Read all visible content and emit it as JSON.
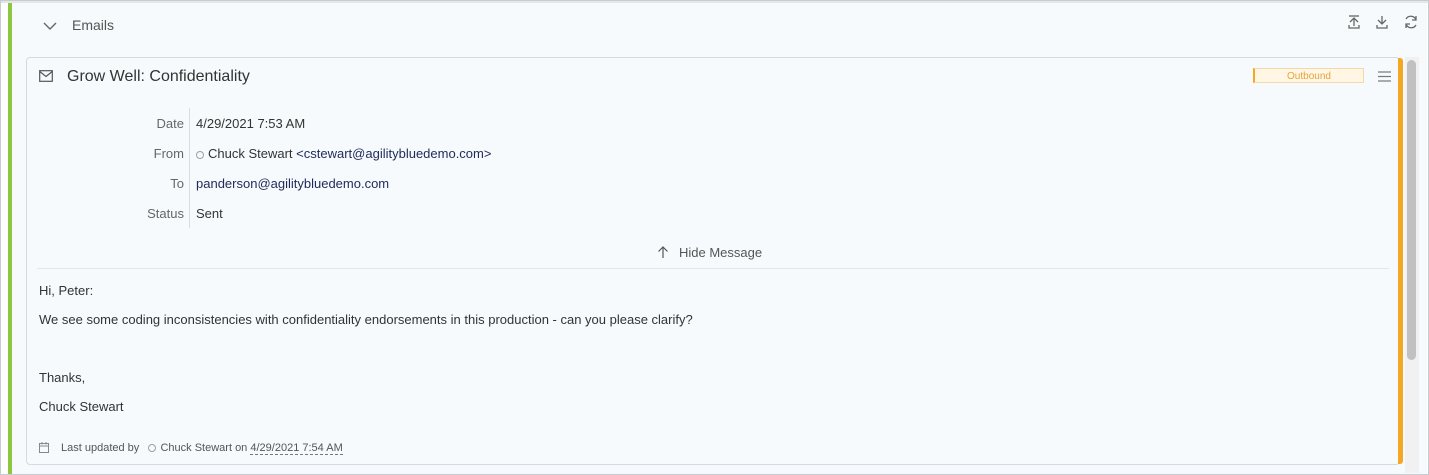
{
  "section": {
    "title": "Emails"
  },
  "email": {
    "subject": "Grow Well: Confidentiality",
    "badge": "Outbound",
    "fields": {
      "date_label": "Date",
      "date_value": "4/29/2021 7:53 AM",
      "from_label": "From",
      "from_name": "Chuck Stewart",
      "from_email": "<cstewart@agilitybluedemo.com>",
      "to_label": "To",
      "to_value": "panderson@agilitybluedemo.com",
      "status_label": "Status",
      "status_value": "Sent"
    },
    "hide_message_label": "Hide Message",
    "body": {
      "greeting": "Hi, Peter:",
      "line1": "We see some coding inconsistencies with confidentiality endorsements in this production - can you please clarify?",
      "closing": "Thanks,",
      "signature": "Chuck Stewart"
    },
    "footer": {
      "prefix": "Last updated by",
      "user": "Chuck Stewart",
      "on": "on",
      "date": "4/29/2021 7:54 AM"
    }
  },
  "icons": {
    "collapse": "chevron-down-icon",
    "upload": "upload-icon",
    "download": "download-icon",
    "refresh": "refresh-icon",
    "mail": "mail-icon",
    "menu": "menu-icon",
    "hide": "arrow-up-icon",
    "calendar": "calendar-icon"
  },
  "colors": {
    "left_accent": "#8dc63f",
    "card_accent": "#f5a623",
    "badge_text": "#e8a33a"
  }
}
